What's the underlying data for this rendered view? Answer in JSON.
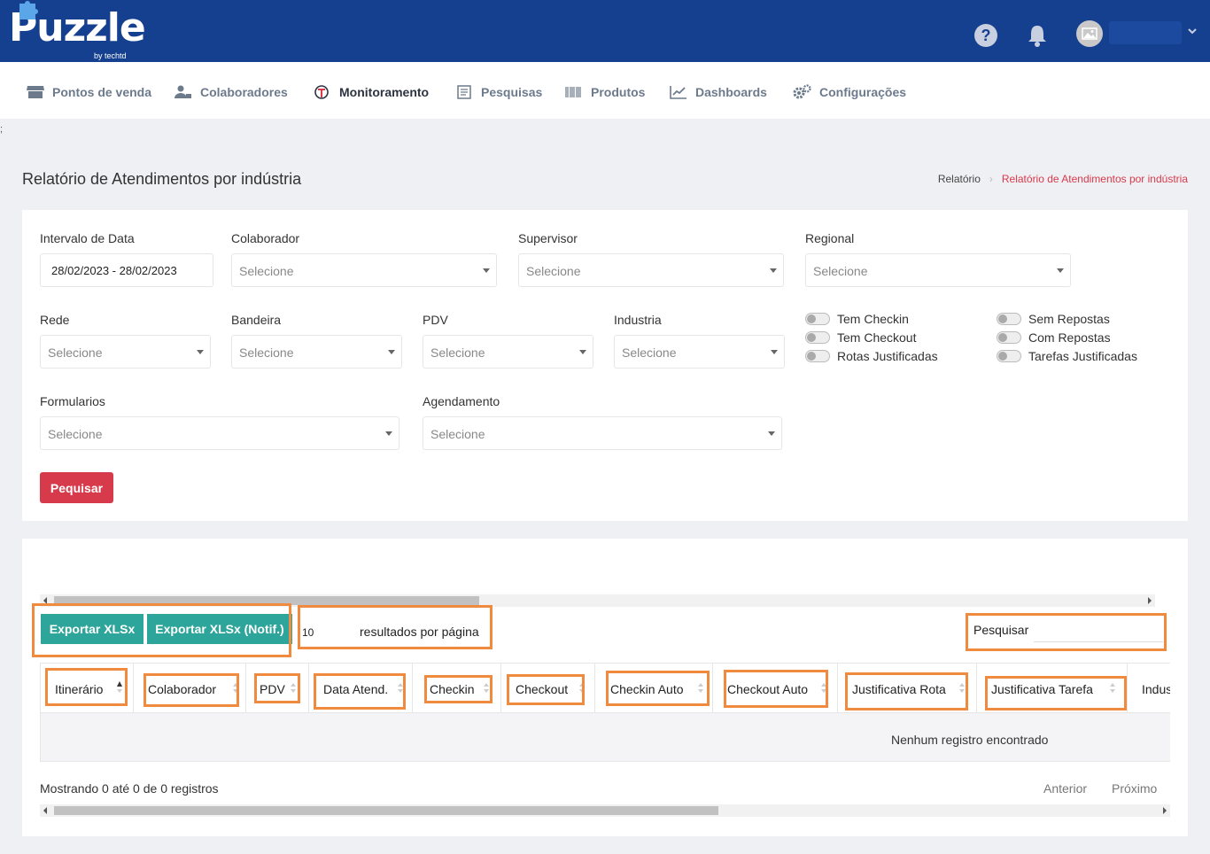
{
  "header": {
    "logo_text": "Puzzle",
    "logo_sub": "by techtd"
  },
  "nav": {
    "items": [
      {
        "label": "Pontos de venda",
        "icon": "store-icon"
      },
      {
        "label": "Colaboradores",
        "icon": "users-icon"
      },
      {
        "label": "Monitoramento",
        "icon": "monitor-icon"
      },
      {
        "label": "Pesquisas",
        "icon": "survey-icon"
      },
      {
        "label": "Produtos",
        "icon": "barcode-icon"
      },
      {
        "label": "Dashboards",
        "icon": "chart-line-icon"
      },
      {
        "label": "Configurações",
        "icon": "gears-icon"
      }
    ]
  },
  "stray_char": ";",
  "page": {
    "title": "Relatório de Atendimentos por indústria",
    "breadcrumb": [
      "Relatório",
      "Relatório de Atendimentos por indústria"
    ]
  },
  "colors": {
    "header": "#15408f",
    "accent_red": "#d73b4b",
    "export_green": "#2ea59a",
    "highlight_orange": "#f08a3e"
  },
  "filters": {
    "date_label": "Intervalo de Data",
    "date_value": "28/02/2023 - 28/02/2023",
    "colaborador_label": "Colaborador",
    "supervisor_label": "Supervisor",
    "regional_label": "Regional",
    "rede_label": "Rede",
    "bandeira_label": "Bandeira",
    "pdv_label": "PDV",
    "industria_label": "Industria",
    "formularios_label": "Formularios",
    "agendamento_label": "Agendamento",
    "placeholder": "Selecione",
    "toggles": [
      "Tem Checkin",
      "Tem Checkout",
      "Rotas Justificadas",
      "Sem Repostas",
      "Com Repostas",
      "Tarefas Justificadas"
    ],
    "search_button": "Pequisar"
  },
  "table": {
    "export_xlsx": "Exportar XLSx",
    "export_xlsx_notif": "Exportar XLSx (Notif.)",
    "per_page_value": "10",
    "per_page_label": "resultados por página",
    "search_label": "Pesquisar",
    "columns": [
      "Itinerário",
      "Colaborador",
      "PDV",
      "Data Atend.",
      "Checkin",
      "Checkout",
      "Checkin Auto",
      "Checkout Auto",
      "Justificativa Rota",
      "Justificativa Tarefa",
      "Indus"
    ],
    "empty_message": "Nenhum registro encontrado",
    "info": "Mostrando 0 até 0 de 0 registros",
    "prev": "Anterior",
    "next": "Próximo"
  }
}
